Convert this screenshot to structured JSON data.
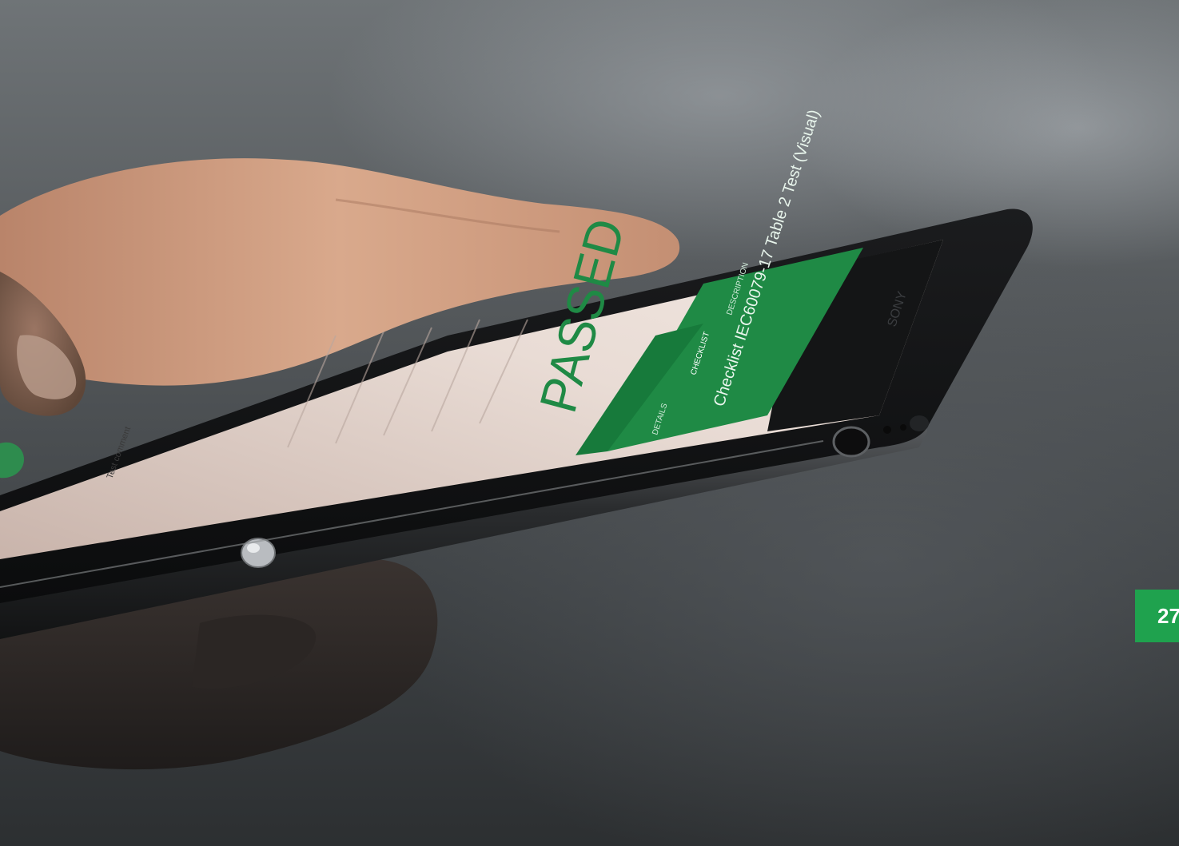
{
  "photo": {
    "screen": {
      "header_text": "Checklist IEC60079-17 Table 2 Test (Visual)",
      "tab_left": "DESCRIPTION",
      "tab_mid": "CHECKLIST",
      "tab_right": "DETAILS",
      "result_text": "PASSED",
      "row_text_1": "Test comment",
      "brand_text": "SONY"
    },
    "colors": {
      "screen_green": "#1f8a45",
      "badge_green": "#1fa24e"
    }
  },
  "page_badge": {
    "number": "27"
  }
}
